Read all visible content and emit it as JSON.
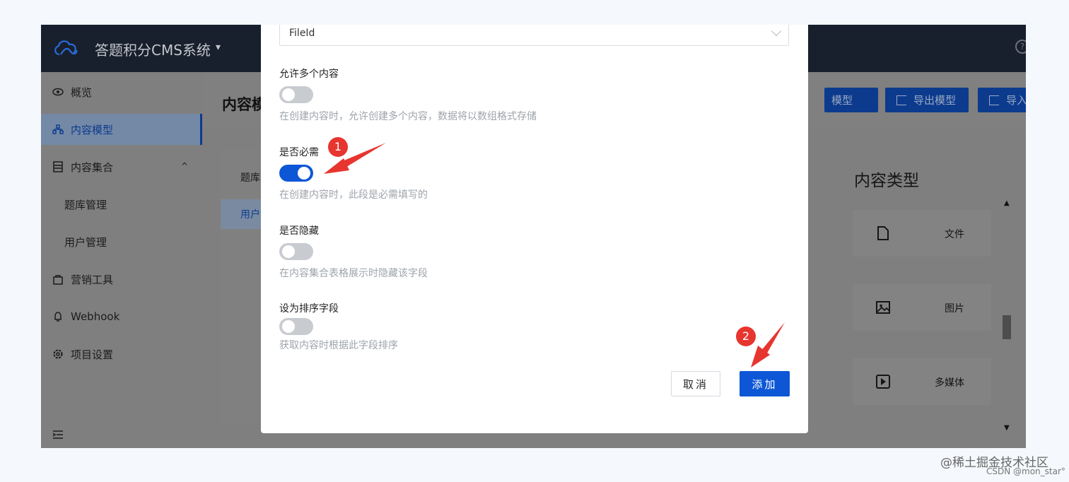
{
  "app": {
    "title": "答题积分CMS系统",
    "caret": "▾",
    "help": "?"
  },
  "sidebar": {
    "items": [
      {
        "label": "概览"
      },
      {
        "label": "内容模型"
      },
      {
        "label": "内容集合",
        "caret": "^"
      },
      {
        "label": "题库管理"
      },
      {
        "label": "用户管理"
      },
      {
        "label": "营销工具"
      },
      {
        "label": "Webhook"
      },
      {
        "label": "项目设置"
      }
    ]
  },
  "main": {
    "title": "内容模",
    "buttons": {
      "create_partial": "模型",
      "export": "导出模型",
      "import": "导入模型"
    },
    "models": [
      "题库",
      "用户"
    ],
    "types": {
      "title": "内容类型",
      "items": [
        {
          "label": "文件",
          "icon": "file-icon"
        },
        {
          "label": "图片",
          "icon": "image-icon"
        },
        {
          "label": "多媒体",
          "icon": "media-icon"
        }
      ]
    }
  },
  "dialog": {
    "select": {
      "value": "FileId"
    },
    "options": [
      {
        "label": "允许多个内容",
        "help": "在创建内容时，允许创建多个内容，数据将以数组格式存储",
        "on": false
      },
      {
        "label": "是否必需",
        "help": "在创建内容时，此段是必需填写的",
        "on": true
      },
      {
        "label": "是否隐藏",
        "help": "在内容集合表格展示时隐藏该字段",
        "on": false
      },
      {
        "label": "设为排序字段",
        "help": "获取内容时根据此字段排序",
        "on": false
      }
    ],
    "cancel_label": "取消",
    "add_label": "添加"
  },
  "annotations": {
    "badge1": "1",
    "badge2": "2",
    "color": "#e7352f"
  },
  "watermark": {
    "line1": "@稀土掘金技术社区",
    "line2": "CSDN @mon_star°"
  }
}
